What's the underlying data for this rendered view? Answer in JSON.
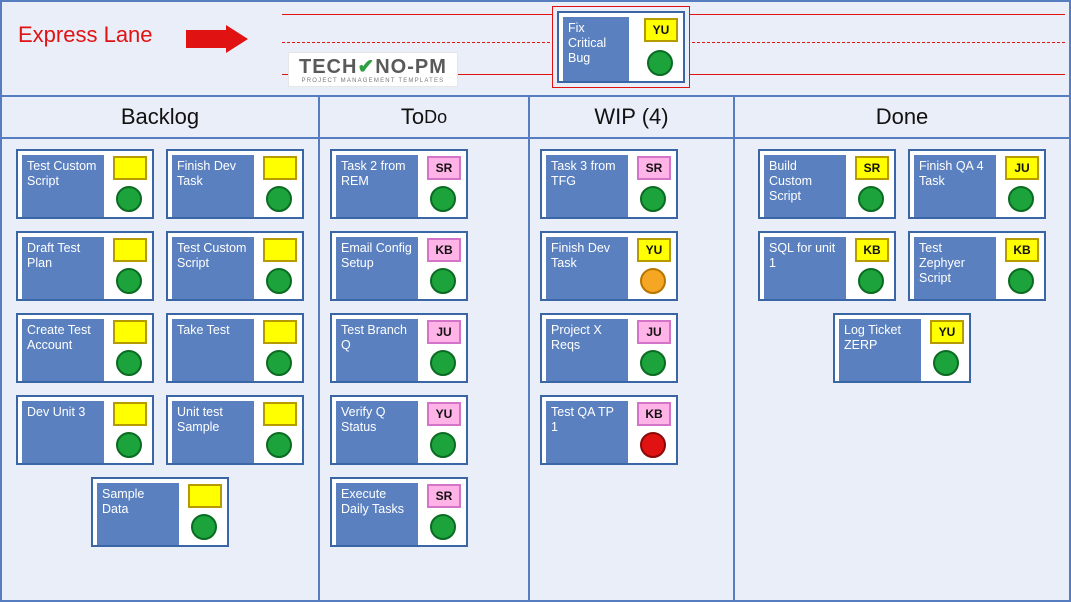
{
  "express": {
    "label": "Express Lane",
    "card": {
      "title": "Fix Critical Bug",
      "owner": "YU",
      "ownerStyle": "yellow",
      "status": "green"
    }
  },
  "logo": {
    "text_pre": "TEC",
    "text_h": "H",
    "text_post": "NO-PM",
    "sub": "PROJECT MANAGEMENT TEMPLATES"
  },
  "columns": {
    "backlog": {
      "title": "Backlog",
      "cards": [
        {
          "title": "Test Custom Script",
          "owner": "",
          "ownerStyle": "yellow",
          "status": "green"
        },
        {
          "title": "Finish Dev Task",
          "owner": "",
          "ownerStyle": "yellow",
          "status": "green"
        },
        {
          "title": "Draft Test Plan",
          "owner": "",
          "ownerStyle": "yellow",
          "status": "green"
        },
        {
          "title": "Test Custom Script",
          "owner": "",
          "ownerStyle": "yellow",
          "status": "green"
        },
        {
          "title": "Create Test Account",
          "owner": "",
          "ownerStyle": "yellow",
          "status": "green"
        },
        {
          "title": "Take Test",
          "owner": "",
          "ownerStyle": "yellow",
          "status": "green"
        },
        {
          "title": "Dev Unit 3",
          "owner": "",
          "ownerStyle": "yellow",
          "status": "green"
        },
        {
          "title": "Unit test Sample",
          "owner": "",
          "ownerStyle": "yellow",
          "status": "green"
        },
        {
          "title": "Sample Data",
          "owner": "",
          "ownerStyle": "yellow",
          "status": "green"
        }
      ]
    },
    "todo": {
      "title_pre": "To ",
      "title_post": "Do",
      "cards": [
        {
          "title": "Task 2 from REM",
          "owner": "SR",
          "ownerStyle": "pink",
          "status": "green"
        },
        {
          "title": "Email Config Setup",
          "owner": "KB",
          "ownerStyle": "pink",
          "status": "green"
        },
        {
          "title": "Test Branch Q",
          "owner": "JU",
          "ownerStyle": "pink",
          "status": "green"
        },
        {
          "title": "Verify Q Status",
          "owner": "YU",
          "ownerStyle": "pink",
          "status": "green"
        },
        {
          "title": "Execute Daily Tasks",
          "owner": "SR",
          "ownerStyle": "pink",
          "status": "green"
        }
      ]
    },
    "wip": {
      "title": "WIP (4)",
      "cards": [
        {
          "title": "Task 3 from TFG",
          "owner": "SR",
          "ownerStyle": "pink",
          "status": "green"
        },
        {
          "title": "Finish Dev Task",
          "owner": "YU",
          "ownerStyle": "yellow",
          "status": "amber"
        },
        {
          "title": "Project X Reqs",
          "owner": "JU",
          "ownerStyle": "pink",
          "status": "green"
        },
        {
          "title": "Test QA TP 1",
          "owner": "KB",
          "ownerStyle": "pink",
          "status": "red"
        }
      ]
    },
    "done": {
      "title": "Done",
      "cards": [
        {
          "title": "Build Custom Script",
          "owner": "SR",
          "ownerStyle": "yellow",
          "status": "green"
        },
        {
          "title": "Finish QA 4 Task",
          "owner": "JU",
          "ownerStyle": "yellow",
          "status": "green"
        },
        {
          "title": "SQL for unit 1",
          "owner": "KB",
          "ownerStyle": "yellow",
          "status": "green"
        },
        {
          "title": "Test Zephyer Script",
          "owner": "KB",
          "ownerStyle": "yellow",
          "status": "green"
        },
        {
          "title": "Log Ticket ZERP",
          "owner": "YU",
          "ownerStyle": "yellow",
          "status": "green"
        }
      ]
    }
  }
}
